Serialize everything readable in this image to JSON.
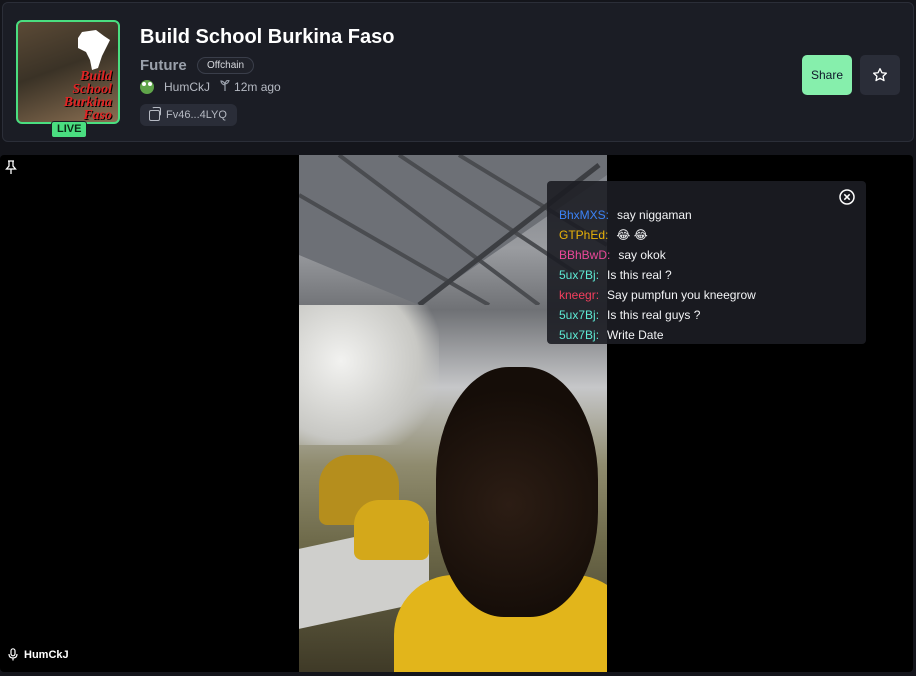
{
  "header": {
    "title": "Build School Burkina Faso",
    "ticker": "Future",
    "chain_badge": "Offchain",
    "live_label": "LIVE",
    "creator": "HumCkJ",
    "age": "12m ago",
    "mint_short": "Fv46...4LYQ",
    "thumbnail_lines": [
      "Build",
      "School",
      "Burkina",
      "Faso"
    ],
    "share_label": "Share",
    "favorite_icon": "star-icon"
  },
  "player": {
    "streamer": "HumCkJ",
    "pin_icon": "pin-icon",
    "mic_icon": "microphone-icon"
  },
  "chat": {
    "close_icon": "close-circle-icon",
    "messages": [
      {
        "user": "BhxMXS:",
        "text": "say niggaman",
        "color": "#3b82f6"
      },
      {
        "user": "GTPhEd:",
        "text": "😂 😂",
        "color": "#eab308"
      },
      {
        "user": "BBhBwD:",
        "text": "say okok",
        "color": "#ec4899"
      },
      {
        "user": "5ux7Bj:",
        "text": "Is this real ?",
        "color": "#5eead4"
      },
      {
        "user": "kneegr:",
        "text": "Say pumpfun you kneegrow",
        "color": "#f43f5e"
      },
      {
        "user": "5ux7Bj:",
        "text": "Is this real guys ?",
        "color": "#5eead4"
      },
      {
        "user": "5ux7Bj:",
        "text": "Write Date",
        "color": "#5eead4"
      }
    ]
  },
  "colors": {
    "accent_green": "#4ade80",
    "share_green": "#86efac",
    "background": "#14151b",
    "panel": "#1b1d25"
  }
}
